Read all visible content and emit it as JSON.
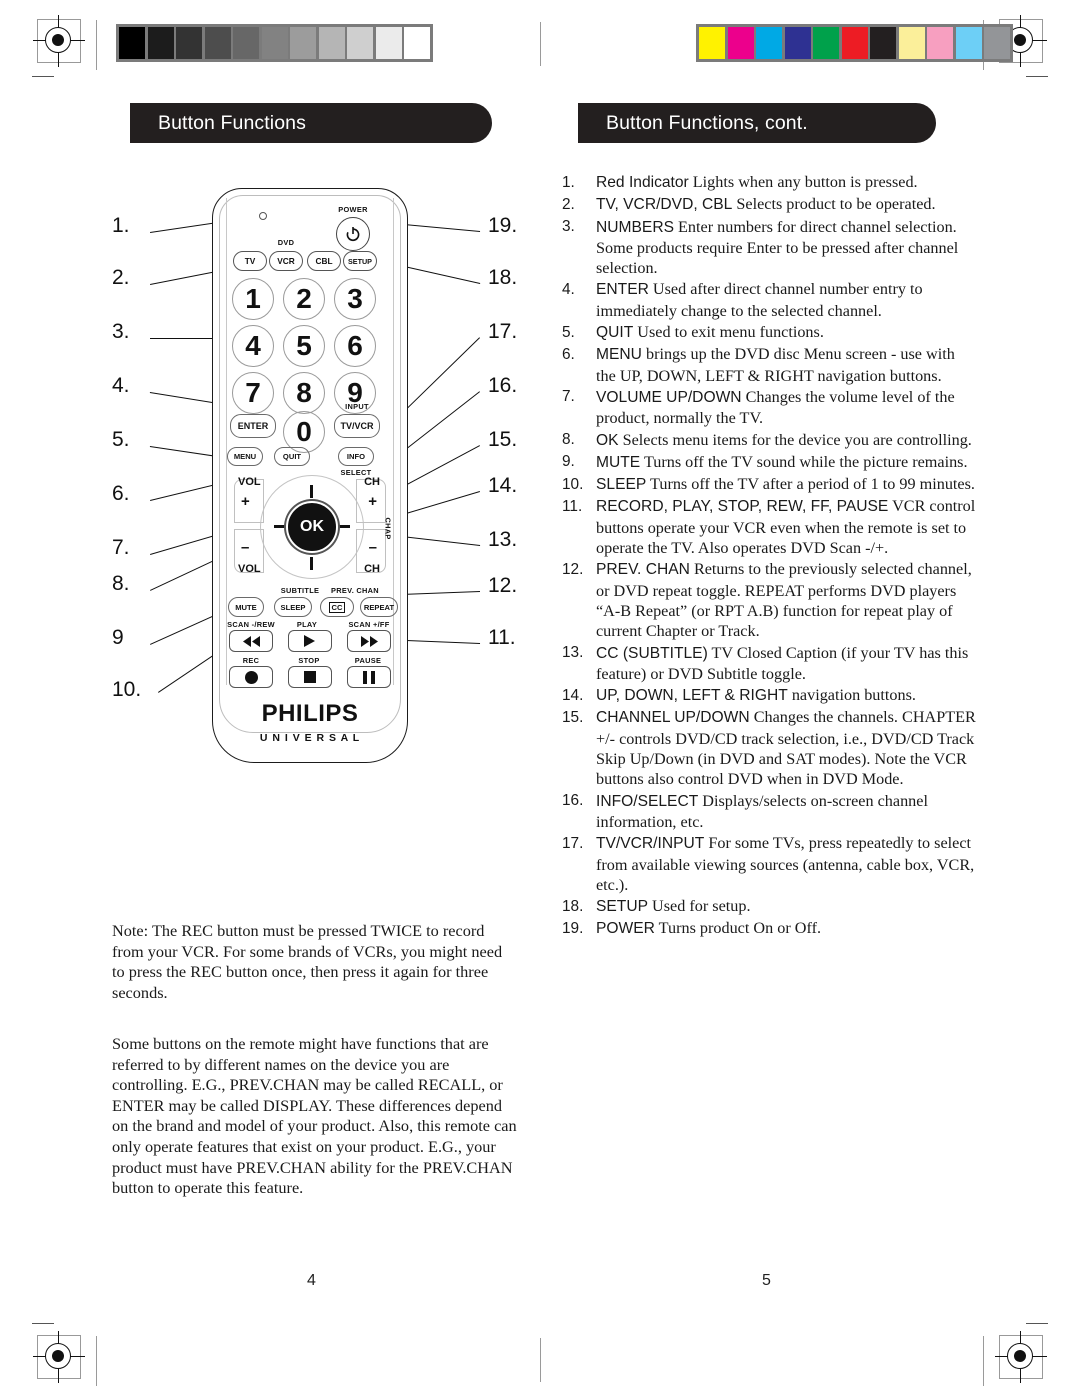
{
  "page": {
    "left_page_number": "4",
    "right_page_number": "5",
    "left_banner": "Button Functions",
    "right_banner": "Button Functions, cont."
  },
  "colors": {
    "banner_bg": "#231f1f",
    "banner_text": "#ffffff",
    "body_text": "#1a1a1a",
    "remote_outline": "#1b1b1b",
    "ok_button": "#111111"
  },
  "print_marks": {
    "gray_wedge": [
      "#000000",
      "#1c1c1c",
      "#333333",
      "#4d4d4d",
      "#676767",
      "#828282",
      "#9c9c9c",
      "#b5b5b5",
      "#cfcfcf",
      "#ebebeb",
      "#ffffff"
    ],
    "color_bar": [
      "#fff200",
      "#ec008c",
      "#00a9e5",
      "#2e3192",
      "#00a14b",
      "#ed1c24",
      "#231f20",
      "#fbef9a",
      "#f79fc0",
      "#6dcff6",
      "#939598"
    ]
  },
  "remote": {
    "brand": "PHILIPS",
    "brand_sub": "U N I V E R S A L",
    "power_label": "POWER",
    "dvd_label": "DVD",
    "device_buttons": [
      "TV",
      "VCR",
      "CBL",
      "SETUP"
    ],
    "numbers": [
      "1",
      "2",
      "3",
      "4",
      "5",
      "6",
      "7",
      "8",
      "9",
      "0"
    ],
    "enter_label": "ENTER",
    "tvvcr_label": "TV/VCR",
    "input_label": "INPUT",
    "menu_label": "MENU",
    "quit_label": "QUIT",
    "info_label": "INFO",
    "select_label": "SELECT",
    "vol_label": "VOL",
    "ch_label": "CH",
    "chap_label": "CHAP",
    "ok_label": "OK",
    "plus": "+",
    "minus": "–",
    "mute_label": "MUTE",
    "sleep_label": "SLEEP",
    "cc_label": "CC",
    "repeat_label": "REPEAT",
    "subtitle_label": "SUBTITLE",
    "prevchan_label": "PREV. CHAN",
    "scan_rew_label": "SCAN -/REW",
    "play_label": "PLAY",
    "scan_ff_label": "SCAN +/FF",
    "rec_label": "REC",
    "stop_label": "STOP",
    "pause_label": "PAUSE"
  },
  "callouts_left": [
    "1.",
    "2.",
    "3.",
    "4.",
    "5.",
    "6.",
    "7.",
    "8.",
    "9",
    "10."
  ],
  "callouts_right": [
    "19.",
    "18.",
    "17.",
    "16.",
    "15.",
    "14.",
    "13.",
    "12.",
    "11."
  ],
  "notes": [
    "Note: The REC button must be pressed TWICE to record from your VCR. For some brands of VCRs, you might need to press the REC button once, then press it again for three seconds.",
    "Some buttons on the remote might have functions that are referred to by different names on the device you are controlling. E.G., PREV.CHAN may be called RECALL, or ENTER may be called DISPLAY. These differences depend on the brand and model of your product. Also, this remote can only operate features that exist on your product. E.G., your product must have PREV.CHAN ability for the PREV.CHAN button to operate this feature."
  ],
  "functions": [
    {
      "num": "1.",
      "button": "Red Indicator",
      "desc": " Lights when any button is pressed."
    },
    {
      "num": "2.",
      "button": "TV, VCR/DVD, CBL",
      "desc": " Selects product to be operated."
    },
    {
      "num": "3.",
      "button": "NUMBERS",
      "desc": " Enter numbers for direct channel selection. Some products require Enter to be pressed after channel selection."
    },
    {
      "num": "4.",
      "button": "ENTER",
      "desc": " Used after direct channel number entry to immediately change to the selected channel."
    },
    {
      "num": "5.",
      "button": "QUIT",
      "desc": " Used to exit menu functions."
    },
    {
      "num": "6.",
      "button": "MENU",
      "desc": " brings up the DVD disc Menu screen - use with the UP, DOWN, LEFT & RIGHT navigation buttons."
    },
    {
      "num": "7.",
      "button": "VOLUME UP/DOWN",
      "desc": " Changes the volume level of the product, normally the TV."
    },
    {
      "num": "8.",
      "button": "OK",
      "desc": " Selects menu items for the device you are controlling."
    },
    {
      "num": "9.",
      "button": "MUTE",
      "desc": " Turns off the TV sound while the picture remains."
    },
    {
      "num": "10.",
      "button": "SLEEP",
      "desc": " Turns off the TV after a period of 1 to 99 minutes."
    },
    {
      "num": "11.",
      "button": "RECORD, PLAY, STOP, REW, FF, PAUSE",
      "desc": " VCR control buttons operate your VCR even when the remote is set to operate the TV. Also operates DVD Scan -/+."
    },
    {
      "num": "12.",
      "button": "PREV. CHAN",
      "desc": " Returns to the previously selected channel, or DVD repeat toggle. REPEAT performs DVD players “A-B Repeat” (or RPT A.B) function for repeat play of current Chapter or Track."
    },
    {
      "num": "13.",
      "button": "CC (SUBTITLE)",
      "desc": " TV Closed Caption (if your TV has this feature) or DVD Subtitle toggle."
    },
    {
      "num": "14.",
      "button": "UP, DOWN, LEFT & RIGHT",
      "desc": " navigation buttons."
    },
    {
      "num": "15.",
      "button": "CHANNEL UP/DOWN",
      "desc": " Changes the channels. CHAPTER +/- controls DVD/CD track selection, i.e., DVD/CD Track Skip Up/Down (in DVD and SAT modes). Note the VCR buttons also control DVD when in DVD Mode."
    },
    {
      "num": "16.",
      "button": "INFO/SELECT",
      "desc": " Displays/selects on-screen channel information, etc."
    },
    {
      "num": "17.",
      "button": "TV/VCR/INPUT",
      "desc": " For some TVs, press repeatedly to select from available viewing sources (antenna, cable box, VCR, etc.)."
    },
    {
      "num": "18.",
      "button": "SETUP",
      "desc": " Used for setup."
    },
    {
      "num": "19.",
      "button": "POWER",
      "desc": " Turns product On or Off."
    }
  ]
}
